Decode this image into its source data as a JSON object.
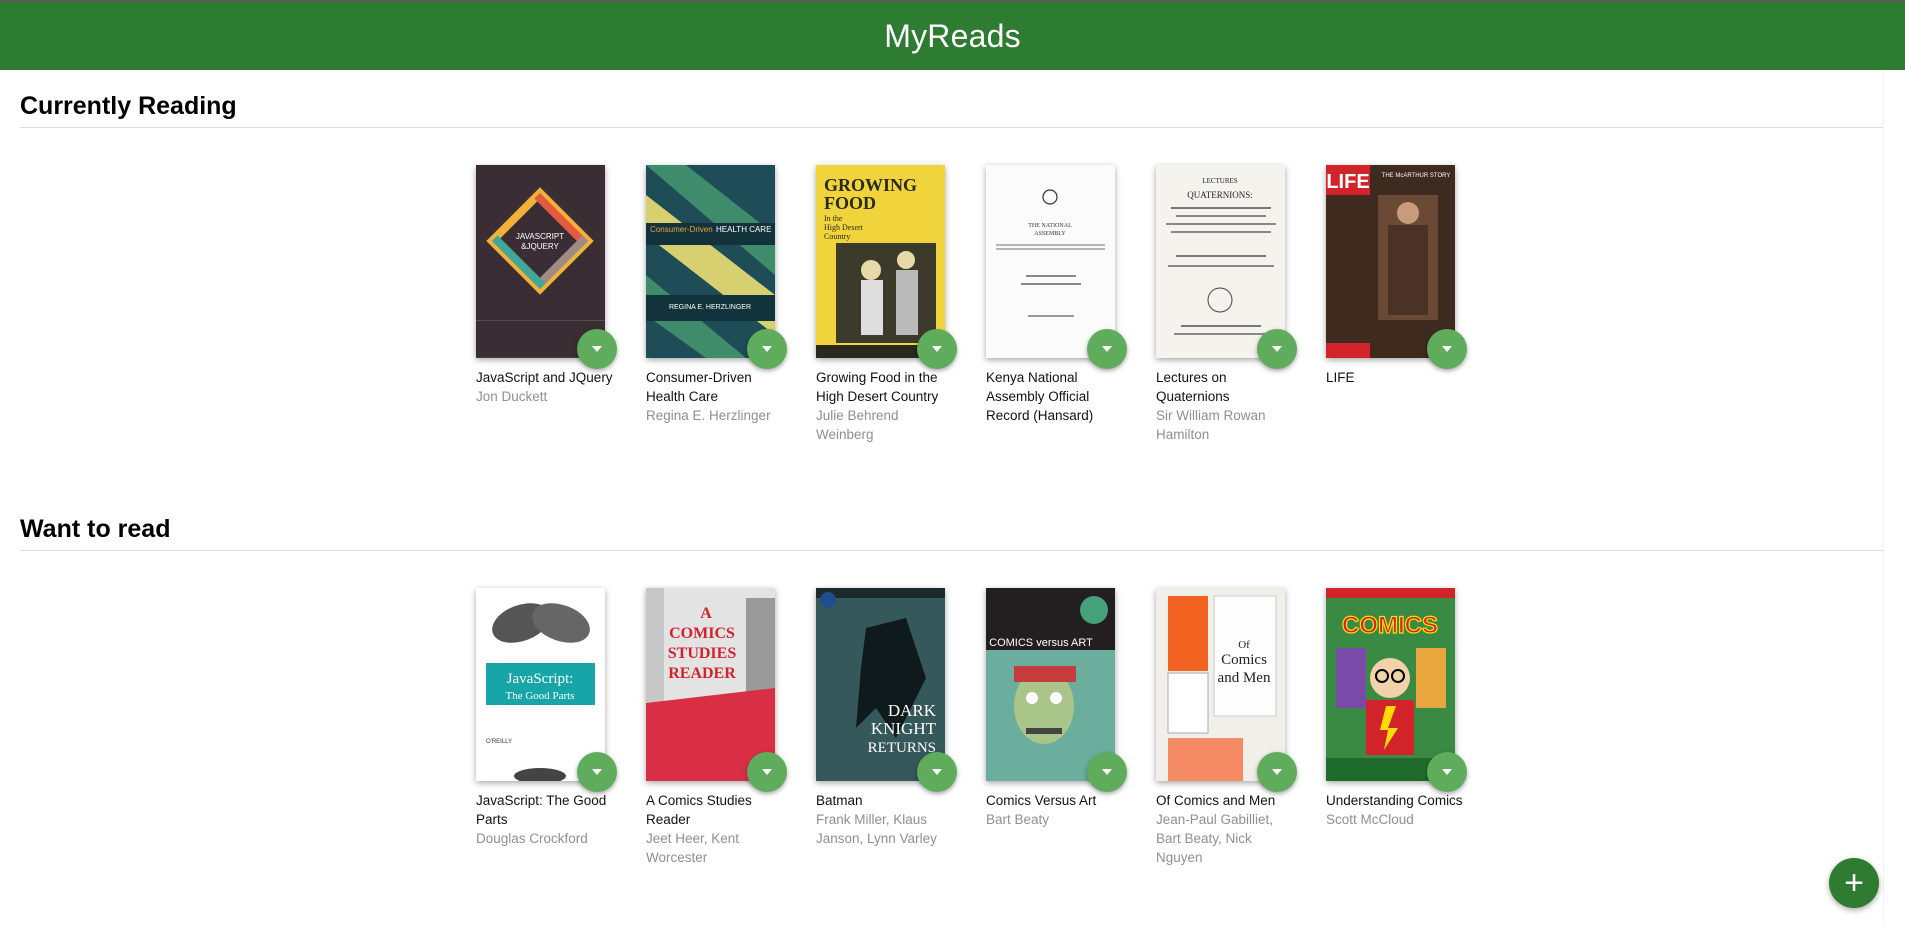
{
  "app": {
    "title": "MyReads"
  },
  "shelves": [
    {
      "title": "Currently Reading",
      "books": [
        {
          "title": "JavaScript and JQuery",
          "authors": "Jon Duckett",
          "cover_text": "JAVASCRIPT & JQUERY"
        },
        {
          "title": "Consumer-Driven Health Care",
          "authors": "Regina E. Herzlinger",
          "cover_text": "Consumer-Driven HEALTH CARE"
        },
        {
          "title": "Growing Food in the High Desert Country",
          "authors": "Julie Behrend Weinberg",
          "cover_text": "GROWING FOOD"
        },
        {
          "title": "Kenya National Assembly Official Record (Hansard)",
          "authors": "",
          "cover_text": "THE NATIONAL ASSEMBLY"
        },
        {
          "title": "Lectures on Quaternions",
          "authors": "Sir William Rowan Hamilton",
          "cover_text": "LECTURES QUATERNIONS"
        },
        {
          "title": "LIFE",
          "authors": "",
          "cover_text": "LIFE"
        }
      ]
    },
    {
      "title": "Want to read",
      "books": [
        {
          "title": "JavaScript: The Good Parts",
          "authors": "Douglas Crockford",
          "cover_text": "JavaScript: The Good Parts"
        },
        {
          "title": "A Comics Studies Reader",
          "authors": "Jeet Heer, Kent Worcester",
          "cover_text": "A COMICS STUDIES READER"
        },
        {
          "title": "Batman",
          "authors": "Frank Miller, Klaus Janson, Lynn Varley",
          "cover_text": "DARK KNIGHT RETURNS"
        },
        {
          "title": "Comics Versus Art",
          "authors": "Bart Beaty",
          "cover_text": "COMICS versus ART"
        },
        {
          "title": "Of Comics and Men",
          "authors": "Jean-Paul Gabilliet, Bart Beaty, Nick Nguyen",
          "cover_text": "Of Comics and Men"
        },
        {
          "title": "Understanding Comics",
          "authors": "Scott McCloud",
          "cover_text": "COMICS"
        }
      ]
    }
  ],
  "add_button": {
    "label": "+",
    "icon": "plus-icon"
  },
  "changer_icon": "chevron-down-icon",
  "colors": {
    "header": "#2e7c31",
    "changer": "#60ac5d",
    "author_text": "#8f8f8f"
  }
}
